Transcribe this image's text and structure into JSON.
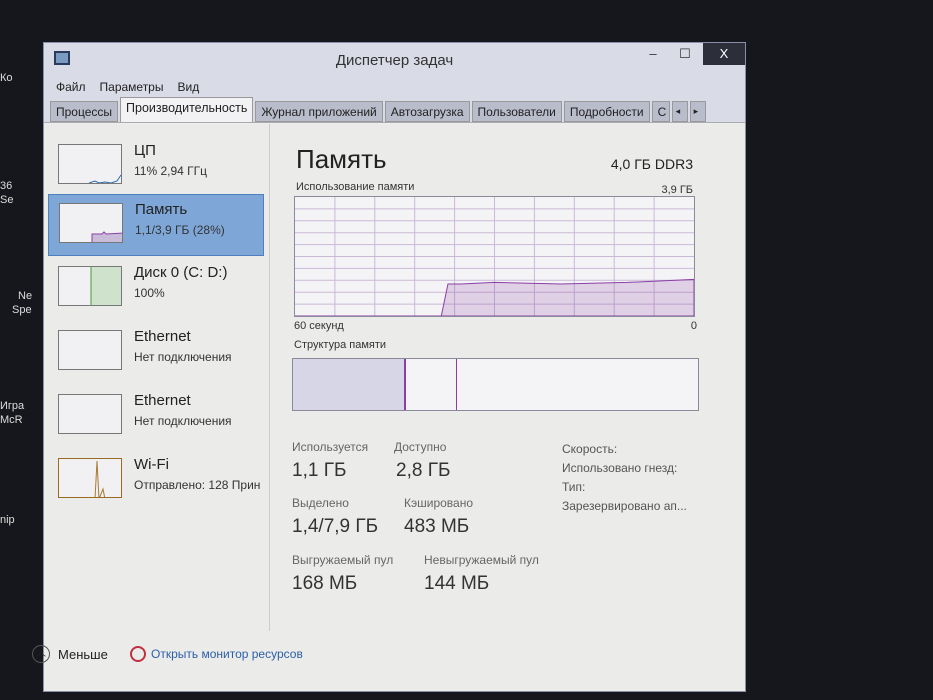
{
  "desktop": {
    "labels": [
      "Ко",
      "36",
      "Se",
      "Ne",
      "Spe",
      "Игра",
      "McR",
      "nip"
    ]
  },
  "window": {
    "title": "Диспетчер задач",
    "minimize": "–",
    "maximize": "☐",
    "close": "X"
  },
  "menu": [
    "Файл",
    "Параметры",
    "Вид"
  ],
  "tabs": [
    "Процессы",
    "Производительность",
    "Журнал приложений",
    "Автозагрузка",
    "Пользователи",
    "Подробности",
    "С"
  ],
  "tab_scroll": {
    "left": "◂",
    "right": "▸"
  },
  "sidebar": [
    {
      "name": "ЦП",
      "sub": "11% 2,94 ГГц"
    },
    {
      "name": "Память",
      "sub": "1,1/3,9 ГБ (28%)"
    },
    {
      "name": "Диск 0 (C: D:)",
      "sub": "100%"
    },
    {
      "name": "Ethernet",
      "sub": "Нет подключения"
    },
    {
      "name": "Ethernet",
      "sub": "Нет подключения"
    },
    {
      "name": "Wi-Fi",
      "sub": "Отправлено: 128 Прин"
    }
  ],
  "main": {
    "title": "Память",
    "spec": "4,0 ГБ DDR3",
    "usage_label": "Использование памяти",
    "usage_max": "3,9 ГБ",
    "time_left": "60 секунд",
    "time_right": "0",
    "structure_label": "Структура памяти",
    "stats": [
      {
        "label": "Используется",
        "value": "1,1 ГБ"
      },
      {
        "label": "Доступно",
        "value": "2,8 ГБ"
      },
      {
        "label": "Выделено",
        "value": "1,4/7,9 ГБ"
      },
      {
        "label": "Кэшировано",
        "value": "483 МБ"
      },
      {
        "label": "Выгружаемый пул",
        "value": "168 МБ"
      },
      {
        "label": "Невыгружаемый пул",
        "value": "144 МБ"
      }
    ],
    "right_labels": [
      "Скорость:",
      "Использовано гнезд:",
      "Тип:",
      "Зарезервировано ап..."
    ]
  },
  "chart_data": {
    "type": "area",
    "title": "Использование памяти",
    "xlabel": "60 секунд → 0",
    "ylim": [
      0,
      3.9
    ],
    "x": [
      60,
      50,
      49,
      38,
      37,
      35,
      30,
      20,
      10,
      0
    ],
    "values": [
      0,
      0,
      0,
      0,
      1.05,
      1.05,
      1.1,
      1.05,
      1.1,
      1.2
    ],
    "structure_fractions": {
      "in_use": 0.28,
      "modified": 0.005,
      "standby": 0.12,
      "free": 0.595
    }
  },
  "footer": {
    "less": "Меньше",
    "monitor": "Открыть монитор ресурсов"
  },
  "colors": {
    "memory": "#8b3fa6",
    "selected": "#7ea7d8"
  }
}
